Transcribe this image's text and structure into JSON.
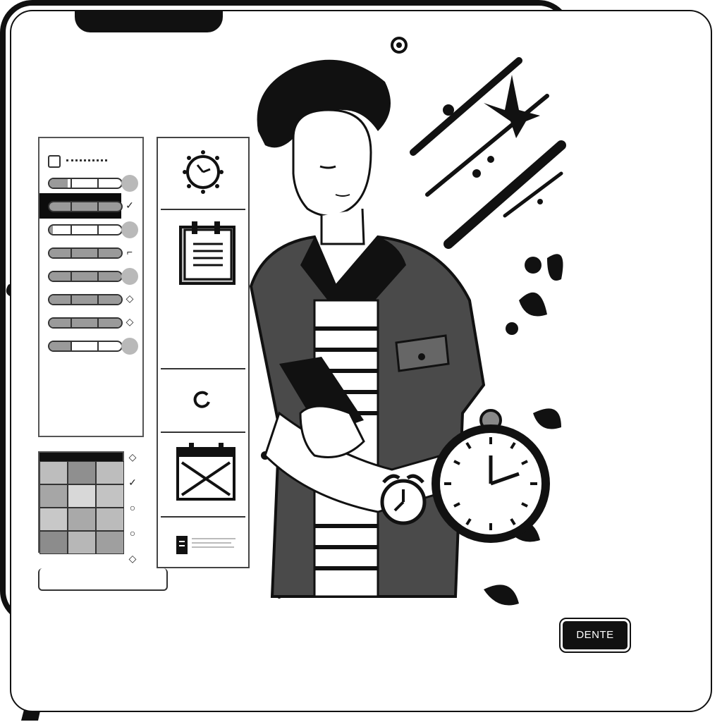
{
  "badge": {
    "label": "DENTE"
  },
  "left_panel": {
    "header_icon": "square-icon",
    "rows": [
      {
        "fill": 0.25,
        "status": "dot"
      },
      {
        "fill": 1.0,
        "status": "check"
      },
      {
        "fill": 0.05,
        "status": "dot"
      },
      {
        "fill": 1.0,
        "status": "dash"
      },
      {
        "fill": 1.0,
        "status": "dot"
      },
      {
        "fill": 1.0,
        "status": "diamond"
      },
      {
        "fill": 1.0,
        "status": "diamond"
      },
      {
        "fill": 0.3,
        "status": "dot"
      }
    ]
  },
  "mid_panel": {
    "icons": [
      "alarm-clock-icon",
      "notepad-icon",
      "refresh-icon",
      "calendar-icon",
      "document-icon"
    ]
  },
  "colors": {
    "ink": "#111111",
    "paper": "#ffffff",
    "gray": "#9a9a9a"
  }
}
